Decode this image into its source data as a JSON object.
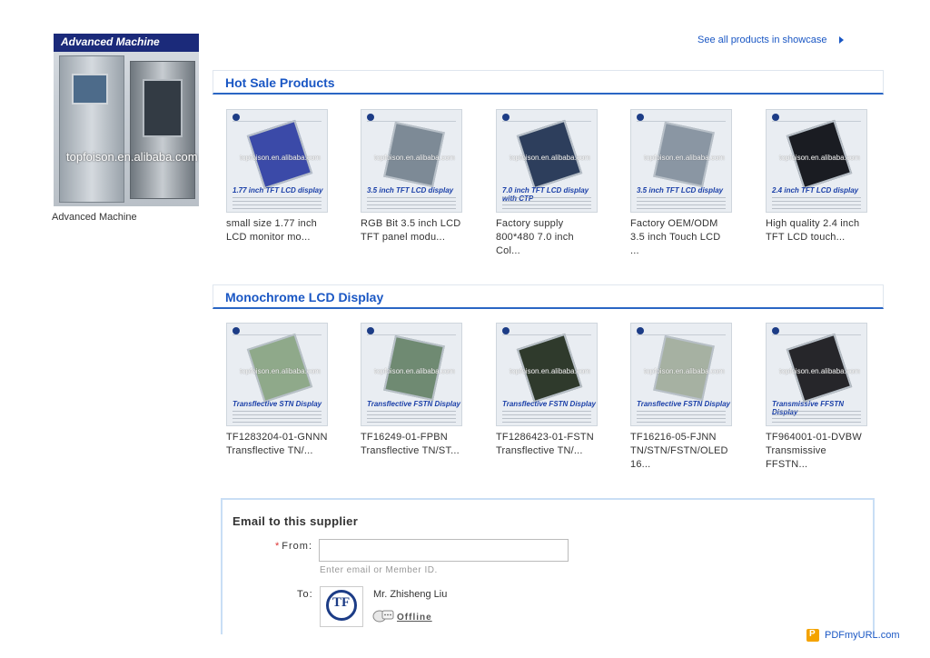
{
  "sidebar": {
    "image_banner": "Advanced Machine",
    "image_watermark": "topfoison.en.alibaba.com",
    "caption": "Advanced Machine"
  },
  "showcase": {
    "link_text": "See all products in showcase",
    "arrow_icon": "triangle-right-icon"
  },
  "hot_sale": {
    "title": "Hot Sale Products",
    "products": [
      {
        "name": "small size 1.77 inch LCD monitor mo...",
        "thumb_label": "1.77 inch TFT LCD display",
        "panel_color": "#3b4aa8"
      },
      {
        "name": "RGB Bit 3.5 inch LCD TFT panel modu...",
        "thumb_label": "3.5 inch TFT LCD display",
        "panel_color": "#7d8a96"
      },
      {
        "name": "Factory supply 800*480 7.0 inch Col...",
        "thumb_label": "7.0 inch TFT LCD display with CTP",
        "panel_color": "#2d3e5c"
      },
      {
        "name": "Factory OEM/ODM 3.5 inch Touch LCD ...",
        "thumb_label": "3.5 inch TFT LCD display",
        "panel_color": "#8a96a3"
      },
      {
        "name": "High quality 2.4 inch TFT LCD touch...",
        "thumb_label": "2.4 inch TFT LCD display",
        "panel_color": "#1a1c22"
      }
    ]
  },
  "monochrome": {
    "title": "Monochrome LCD Display",
    "products": [
      {
        "name": "TF1283204-01-GNNN Transflective TN/...",
        "thumb_label": "Transflective STN Display",
        "panel_color": "#8fa98a"
      },
      {
        "name": "TF16249-01-FPBN Transflective TN/ST...",
        "thumb_label": "Transflective FSTN Display",
        "panel_color": "#6f8a72"
      },
      {
        "name": "TF1286423-01-FSTN Transflective TN/...",
        "thumb_label": "Transflective FSTN Display",
        "panel_color": "#2f3a2c"
      },
      {
        "name": "TF16216-05-FJNN TN/STN/FSTN/OLED 16...",
        "thumb_label": "Transflective FSTN Display",
        "panel_color": "#a6b1a2"
      },
      {
        "name": "TF964001-01-DVBW Transmissive FFSTN...",
        "thumb_label": "Transmissive FFSTN Display",
        "panel_color": "#26262a"
      }
    ]
  },
  "email": {
    "title": "Email to this supplier",
    "from_label": "From:",
    "required_mark": "*",
    "from_value": "",
    "from_hint": "Enter email or Member ID.",
    "to_label": "To:",
    "supplier_name": "Mr. Zhisheng Liu",
    "status": "Offline",
    "avatar_text": "TF"
  },
  "footer": {
    "pdf_icon_text": "P",
    "pdf_text": "PDFmyURL.com"
  }
}
